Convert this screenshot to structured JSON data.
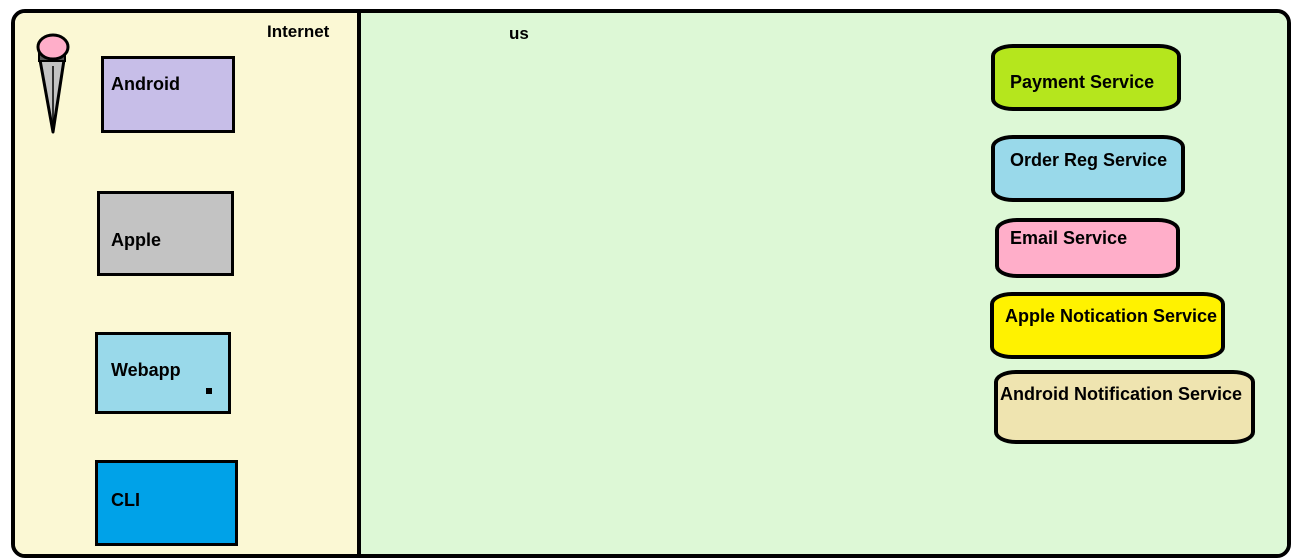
{
  "zones": {
    "internet": {
      "label": "Internet",
      "color": "#fbf8d4"
    },
    "us": {
      "label": "us",
      "color": "#ddf8d6"
    }
  },
  "clients": [
    {
      "id": "android",
      "label": "Android",
      "color": "#c7bee8"
    },
    {
      "id": "apple",
      "label": "Apple",
      "color": "#c3c3c3"
    },
    {
      "id": "webapp",
      "label": "Webapp",
      "color": "#99d9ea"
    },
    {
      "id": "cli",
      "label": "CLI",
      "color": "#00a2e8"
    }
  ],
  "services": [
    {
      "id": "payment",
      "label": "Payment Service",
      "color": "#b5e61d"
    },
    {
      "id": "order-reg",
      "label": "Order Reg Service",
      "color": "#99d9ea"
    },
    {
      "id": "email",
      "label": "Email  Service",
      "color": "#ffaec9"
    },
    {
      "id": "apple-notification",
      "label": "Apple Notication Service",
      "color": "#fff200"
    },
    {
      "id": "android-notification",
      "label": "Android Notification Service",
      "color": "#efe4b0"
    }
  ],
  "icons": {
    "user": "microphone-icon"
  }
}
